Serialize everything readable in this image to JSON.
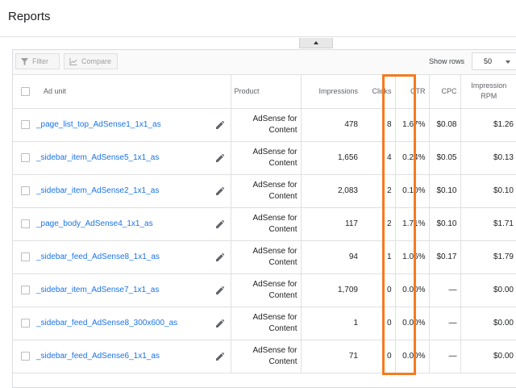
{
  "page": {
    "title": "Reports"
  },
  "toolbar": {
    "filter_label": "Filter",
    "compare_label": "Compare",
    "show_rows_label": "Show rows",
    "show_rows_value": "50"
  },
  "table": {
    "headers": {
      "ad_unit": "Ad unit",
      "product": "Product",
      "impressions": "Impressions",
      "clicks": "Clicks",
      "ctr": "CTR",
      "cpc": "CPC",
      "rpm_line1": "Impression",
      "rpm_line2": "RPM"
    },
    "rows": [
      {
        "ad_unit": "_page_list_top_AdSense1_1x1_as",
        "product_line1": "AdSense for",
        "product_line2": "Content",
        "impressions": "478",
        "clicks": "8",
        "ctr": "1.67%",
        "cpc": "$0.08",
        "rpm": "$1.26"
      },
      {
        "ad_unit": "_sidebar_item_AdSense5_1x1_as",
        "product_line1": "AdSense for",
        "product_line2": "Content",
        "impressions": "1,656",
        "clicks": "4",
        "ctr": "0.24%",
        "cpc": "$0.05",
        "rpm": "$0.13"
      },
      {
        "ad_unit": "_sidebar_item_AdSense2_1x1_as",
        "product_line1": "AdSense for",
        "product_line2": "Content",
        "impressions": "2,083",
        "clicks": "2",
        "ctr": "0.10%",
        "cpc": "$0.10",
        "rpm": "$0.10"
      },
      {
        "ad_unit": "_page_body_AdSense4_1x1_as",
        "product_line1": "AdSense for",
        "product_line2": "Content",
        "impressions": "117",
        "clicks": "2",
        "ctr": "1.71%",
        "cpc": "$0.10",
        "rpm": "$1.71"
      },
      {
        "ad_unit": "_sidebar_feed_AdSense8_1x1_as",
        "product_line1": "AdSense for",
        "product_line2": "Content",
        "impressions": "94",
        "clicks": "1",
        "ctr": "1.06%",
        "cpc": "$0.17",
        "rpm": "$1.79"
      },
      {
        "ad_unit": "_sidebar_item_AdSense7_1x1_as",
        "product_line1": "AdSense for",
        "product_line2": "Content",
        "impressions": "1,709",
        "clicks": "0",
        "ctr": "0.00%",
        "cpc": "—",
        "rpm": "$0.00"
      },
      {
        "ad_unit": "_sidebar_feed_AdSense8_300x600_as",
        "product_line1": "AdSense for",
        "product_line2": "Content",
        "impressions": "1",
        "clicks": "0",
        "ctr": "0.00%",
        "cpc": "—",
        "rpm": "$0.00"
      },
      {
        "ad_unit": "_sidebar_feed_AdSense6_1x1_as",
        "product_line1": "AdSense for",
        "product_line2": "Content",
        "impressions": "71",
        "clicks": "0",
        "ctr": "0.00%",
        "cpc": "—",
        "rpm": "$0.00"
      }
    ]
  },
  "colors": {
    "link": "#1a73e8",
    "highlight": "#f47b20"
  },
  "icons": {
    "filter": "filter-icon",
    "compare": "chart-icon",
    "edit": "pencil-icon",
    "collapse": "caret-up-icon"
  }
}
